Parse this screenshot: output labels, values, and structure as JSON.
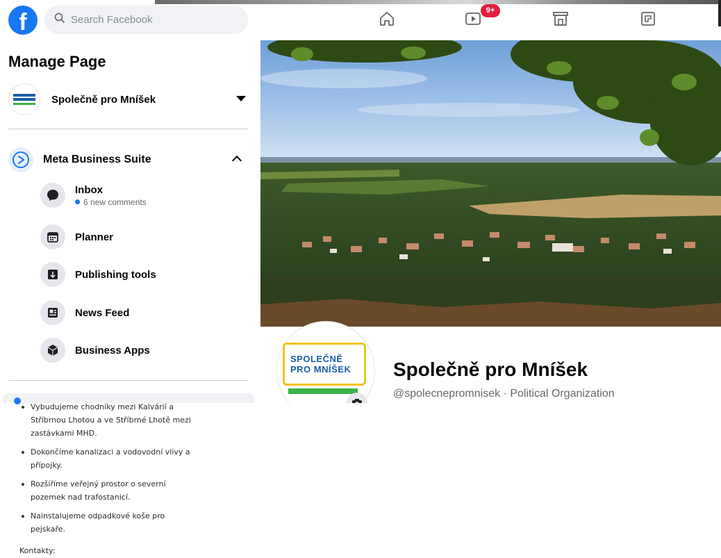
{
  "topbar": {
    "logo_letter": "f",
    "search_placeholder": "Search Facebook",
    "video_badge": "9+"
  },
  "left_panel": {
    "title": "Manage Page",
    "page_name": "Společně pro Mníšek",
    "business_suite_label": "Meta Business Suite",
    "items": [
      {
        "label": "Inbox",
        "sub": "6 new comments"
      },
      {
        "label": "Planner"
      },
      {
        "label": "Publishing tools"
      },
      {
        "label": "News Feed"
      },
      {
        "label": "Business Apps"
      }
    ]
  },
  "lower_text": {
    "bullets": [
      "Vybudujeme chodníky mezi Kalvárií a Stříbrnou Lhotou a ve Stříbrné Lhotě mezi zastávkami MHD.",
      "Dokončíme kanalizaci a vodovodní vlivy a přípojky.",
      "Rozšíříme veřejný prostor o severní pozemek nad trafostanicí.",
      "Nainstalujeme odpadkové koše pro pejskaře."
    ],
    "footer": "Kontakty:"
  },
  "profile": {
    "name": "Společně pro Mníšek",
    "handle": "@spolecnepromnisek · Political Organization",
    "logo_line1": "SPOLEČNĚ",
    "logo_line2": "PRO MNÍŠEK"
  },
  "colors": {
    "facebook_blue": "#1877f2",
    "badge_red": "#e41e3f",
    "logo_blue": "#1a5fa8",
    "logo_yellow": "#f0c419",
    "logo_green": "#3cb34a"
  }
}
